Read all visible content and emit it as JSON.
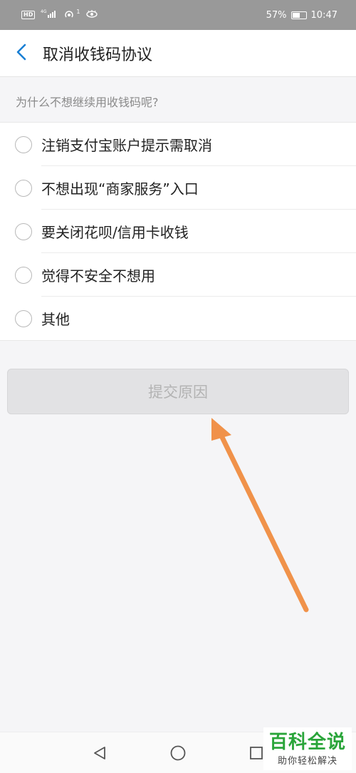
{
  "status_bar": {
    "hd": "HD",
    "signal_label": "4G",
    "notification_count": "1",
    "battery_percent": "57%",
    "time": "10:47"
  },
  "header": {
    "title": "取消收钱码协议"
  },
  "question": "为什么不想继续用收钱码呢?",
  "options": [
    {
      "label": "注销支付宝账户提示需取消"
    },
    {
      "label": "不想出现“商家服务”入口"
    },
    {
      "label": "要关闭花呗/信用卡收钱"
    },
    {
      "label": "觉得不安全不想用"
    },
    {
      "label": "其他"
    }
  ],
  "submit_label": "提交原因",
  "watermark": {
    "title": "百科全说",
    "subtitle": "助你轻松解决"
  },
  "colors": {
    "accent": "#1a7fd4",
    "arrow": "#f0924a",
    "watermark_green": "#2aa53a"
  }
}
